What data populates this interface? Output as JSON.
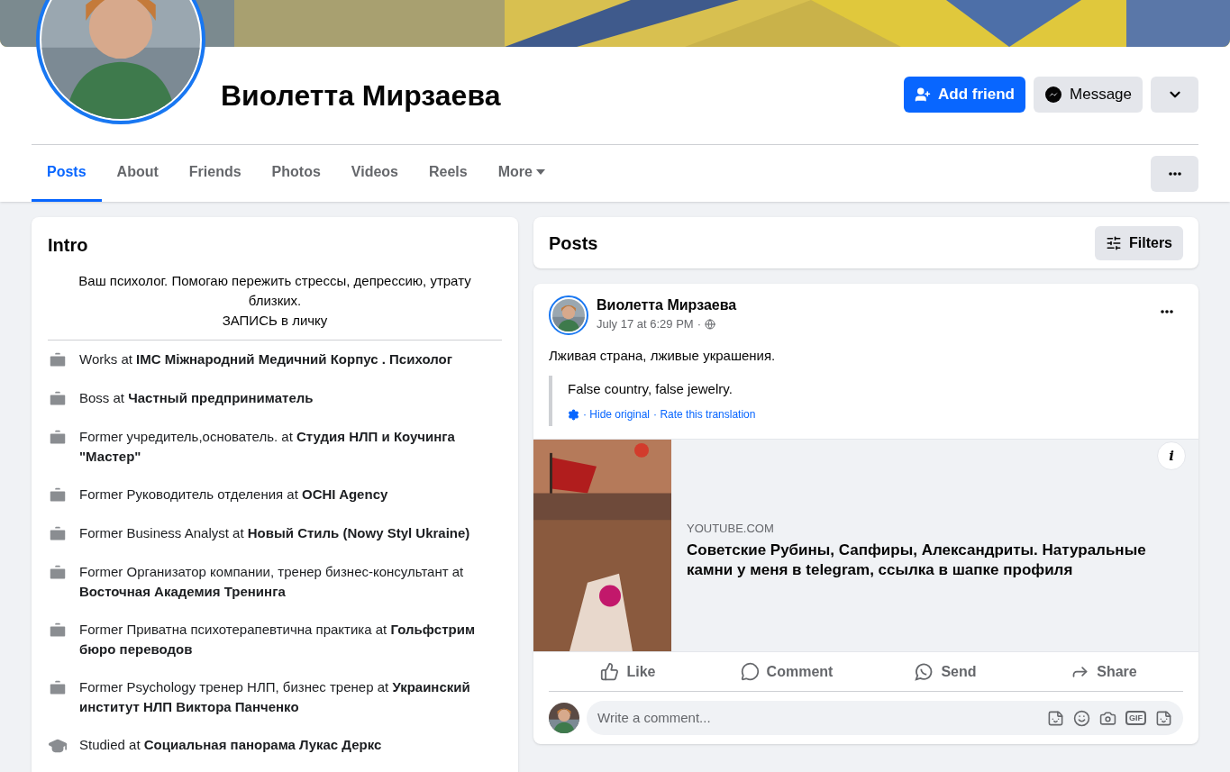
{
  "profile": {
    "name": "Виолетта Мирзаева",
    "actions": [
      {
        "kind": "add",
        "label": "Add friend"
      },
      {
        "kind": "message",
        "label": "Message"
      },
      {
        "kind": "dropdown"
      }
    ]
  },
  "tabs": [
    {
      "label": "Posts",
      "selected": true
    },
    {
      "label": "About",
      "selected": false
    },
    {
      "label": "Friends",
      "selected": false
    },
    {
      "label": "Photos",
      "selected": false
    },
    {
      "label": "Videos",
      "selected": false
    },
    {
      "label": "Reels",
      "selected": false
    },
    {
      "label": "More",
      "selected": false,
      "dropdown": true
    }
  ],
  "intro": {
    "title": "Intro",
    "bio": [
      "Ваш психолог. Помогаю пережить стрессы, депрессию, утрату близких.",
      "ЗАПИСЬ в личку"
    ],
    "items": [
      {
        "kind": "work",
        "text": "Works at **IMC Міжнародний Медичний Корпус . Психолог**"
      },
      {
        "kind": "work",
        "text": "Boss at **Частный предприниматель**"
      },
      {
        "kind": "work",
        "text": "Former учредитель,основатель. at **Студия НЛП и Коучинга \"Мастер\"**"
      },
      {
        "kind": "work",
        "text": "Former Руководитель отделения at **OCHI Agency**"
      },
      {
        "kind": "work",
        "text": "Former Business Analyst at **Новый Стиль (Nowy Styl Ukraine)**"
      },
      {
        "kind": "work",
        "text": "Former Организатор компании, тренер бизнес-консультант at **Восточная Академия Тренинга**"
      },
      {
        "kind": "work",
        "text": "Former Приватна психотерапевтична практика at **Гольфстрим бюро переводов**"
      },
      {
        "kind": "work",
        "text": "Former Psychology тренер НЛП, бизнес тренер at **Украинский институт НЛП Виктора Панченко**"
      },
      {
        "kind": "education",
        "text": "Studied at **Социальная панорама Лукас Деркс**"
      }
    ]
  },
  "posts_header": {
    "title": "Posts",
    "filters": "Filters"
  },
  "post": {
    "author": "Виолетта Мирзаева",
    "time": "July 17 at 6:29 PM",
    "separator": "·",
    "text": "Лживая страна, лживые украшения.",
    "translation": "False country, false jewelry.",
    "translation_links": [
      "· Hide original",
      "· Rate this translation"
    ],
    "link": {
      "domain": "YOUTUBE.COM",
      "title": "Советские Рубины, Сапфиры, Александриты. Натуральные камни у меня в telegram, ссылка в шапке профиля",
      "info": "i"
    },
    "actions": [
      {
        "kind": "like",
        "label": "Like"
      },
      {
        "kind": "comment",
        "label": "Comment"
      },
      {
        "kind": "send",
        "label": "Send"
      },
      {
        "kind": "share",
        "label": "Share"
      }
    ],
    "comment_box": {
      "placeholder": "Write a comment...",
      "gif_label": "GIF"
    }
  }
}
